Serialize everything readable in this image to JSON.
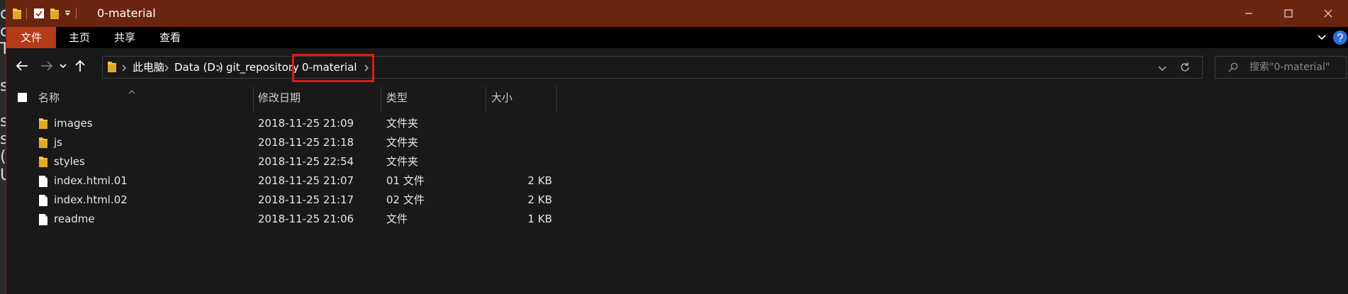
{
  "window": {
    "title": "0-material",
    "minimize_label": "Minimize",
    "maximize_label": "Maximize",
    "close_label": "Close"
  },
  "ribbon": {
    "tabs": [
      {
        "label": "文件"
      },
      {
        "label": "主页"
      },
      {
        "label": "共享"
      },
      {
        "label": "查看"
      }
    ]
  },
  "address_bar": {
    "crumbs": [
      {
        "label": "此电脑"
      },
      {
        "label": "Data (D:)"
      },
      {
        "label": "git_repository"
      },
      {
        "label": "0-material"
      }
    ],
    "highlighted": "0-material"
  },
  "search": {
    "placeholder": "搜索\"0-material\""
  },
  "file_list": {
    "columns": {
      "name": "名称",
      "modified": "修改日期",
      "type": "类型",
      "size": "大小"
    },
    "rows": [
      {
        "name": "images",
        "modified": "2018-11-25 21:09",
        "type": "文件夹",
        "size": "",
        "icon": "folder-icon"
      },
      {
        "name": "js",
        "modified": "2018-11-25 21:18",
        "type": "文件夹",
        "size": "",
        "icon": "folder-icon"
      },
      {
        "name": "styles",
        "modified": "2018-11-25 22:54",
        "type": "文件夹",
        "size": "",
        "icon": "folder-icon"
      },
      {
        "name": "index.html.01",
        "modified": "2018-11-25 21:07",
        "type": "01 文件",
        "size": "2 KB",
        "icon": "file-icon"
      },
      {
        "name": "index.html.02",
        "modified": "2018-11-25 21:17",
        "type": "02 文件",
        "size": "2 KB",
        "icon": "file-icon"
      },
      {
        "name": "readme",
        "modified": "2018-11-25 21:06",
        "type": "文件",
        "size": "1 KB",
        "icon": "file-icon"
      }
    ]
  },
  "colors": {
    "titlebar": "#6b2410",
    "file_tab": "#b53a17",
    "highlight": "#e01818",
    "background": "#191919",
    "folder": "#f3c54a"
  }
}
